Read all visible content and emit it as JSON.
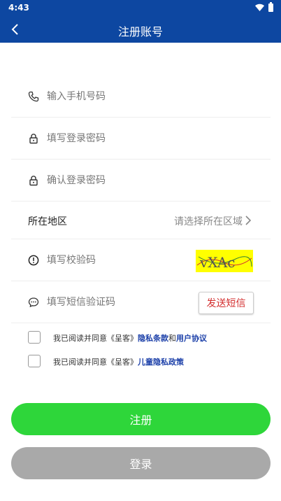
{
  "status": {
    "time": "4:43"
  },
  "appbar": {
    "title": "注册账号"
  },
  "form": {
    "phone_placeholder": "输入手机号码",
    "password_placeholder": "填写登录密码",
    "confirm_placeholder": "确认登录密码",
    "region_label": "所在地区",
    "region_value": "请选择所在区域",
    "captcha_placeholder": "填写校验码",
    "captcha_text": "vXAc",
    "sms_placeholder": "填写短信验证码",
    "sms_button": "发送短信"
  },
  "agreements": [
    {
      "prefix": "我已阅读并同意《呈客》",
      "link1": "隐私条款",
      "joiner": "和",
      "link2": "用户协议"
    },
    {
      "prefix": "我已阅读并同意《呈客》",
      "link1": "儿童隐私政策"
    }
  ],
  "buttons": {
    "register": "注册",
    "login": "登录"
  },
  "colors": {
    "header": "#0d47a1",
    "register": "#2ed63a",
    "login": "#a9a9a9",
    "link": "#1a3ea8",
    "sms_text": "#d32f2f",
    "captcha_bg": "#ffff00"
  }
}
